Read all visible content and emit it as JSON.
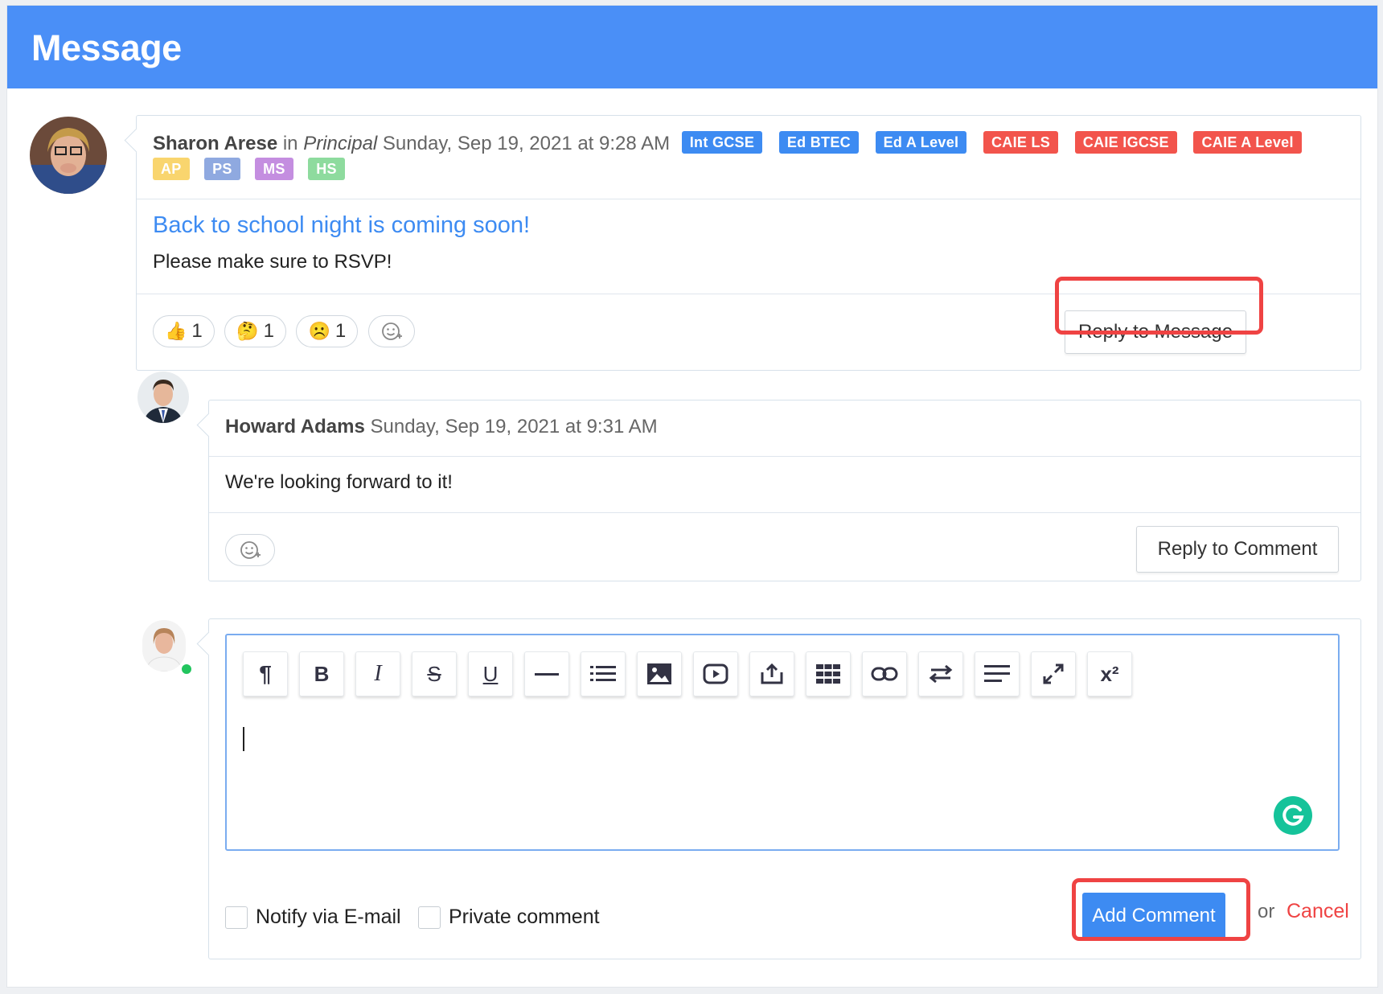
{
  "page": {
    "title": "Message"
  },
  "message": {
    "author": "Sharon Arese",
    "in_word": "in",
    "group": "Principal",
    "timestamp": "Sunday, Sep 19, 2021 at 9:28 AM",
    "tags": [
      {
        "label": "Int GCSE",
        "color": "#3d8bf2"
      },
      {
        "label": "Ed BTEC",
        "color": "#3d8bf2"
      },
      {
        "label": "Ed A Level",
        "color": "#3d8bf2"
      },
      {
        "label": "CAIE LS",
        "color": "#f2544c"
      },
      {
        "label": "CAIE IGCSE",
        "color": "#f2544c"
      },
      {
        "label": "CAIE A Level",
        "color": "#f2544c"
      },
      {
        "label": "AP",
        "color": "#f9d56e"
      },
      {
        "label": "PS",
        "color": "#8fa9e0"
      },
      {
        "label": "MS",
        "color": "#c48ee0"
      },
      {
        "label": "HS",
        "color": "#8edb9e"
      }
    ],
    "subject": "Back to school night is coming soon!",
    "body": "Please make sure to RSVP!",
    "reactions": [
      {
        "emoji": "👍",
        "count": "1"
      },
      {
        "emoji": "🤔",
        "count": "1"
      },
      {
        "emoji": "☹️",
        "count": "1"
      }
    ],
    "add_reaction_icon": "smiley-plus-icon",
    "reply_label": "Reply to Message"
  },
  "comment": {
    "author": "Howard Adams",
    "timestamp": "Sunday, Sep 19, 2021 at 9:31 AM",
    "body": "We're looking forward to it!",
    "reply_label": "Reply to Comment"
  },
  "composer": {
    "toolbar": [
      {
        "name": "paragraph-icon",
        "glyph": "¶"
      },
      {
        "name": "bold-icon",
        "glyph": "B"
      },
      {
        "name": "italic-icon",
        "glyph": "I"
      },
      {
        "name": "strikethrough-icon",
        "glyph": "S"
      },
      {
        "name": "underline-icon",
        "glyph": "U"
      },
      {
        "name": "horizontal-rule-icon",
        "glyph": "—"
      },
      {
        "name": "list-icon",
        "glyph": "≡"
      },
      {
        "name": "image-icon",
        "glyph": "img"
      },
      {
        "name": "video-icon",
        "glyph": "▶"
      },
      {
        "name": "upload-icon",
        "glyph": "⇪"
      },
      {
        "name": "table-icon",
        "glyph": "▦"
      },
      {
        "name": "link-icon",
        "glyph": "🔗"
      },
      {
        "name": "swap-icon",
        "glyph": "⇆"
      },
      {
        "name": "align-icon",
        "glyph": "≡"
      },
      {
        "name": "fullscreen-icon",
        "glyph": "⤢"
      },
      {
        "name": "superscript-icon",
        "glyph": "x²"
      }
    ],
    "notify_label": "Notify via E-mail",
    "private_label": "Private comment",
    "submit_label": "Add Comment",
    "or_label": "or",
    "cancel_label": "Cancel"
  },
  "colors": {
    "accent": "#4a8ff7",
    "highlight": "#ef4343",
    "cancel": "#ef4343",
    "online": "#22c55e",
    "grammarly": "#15c39a"
  }
}
